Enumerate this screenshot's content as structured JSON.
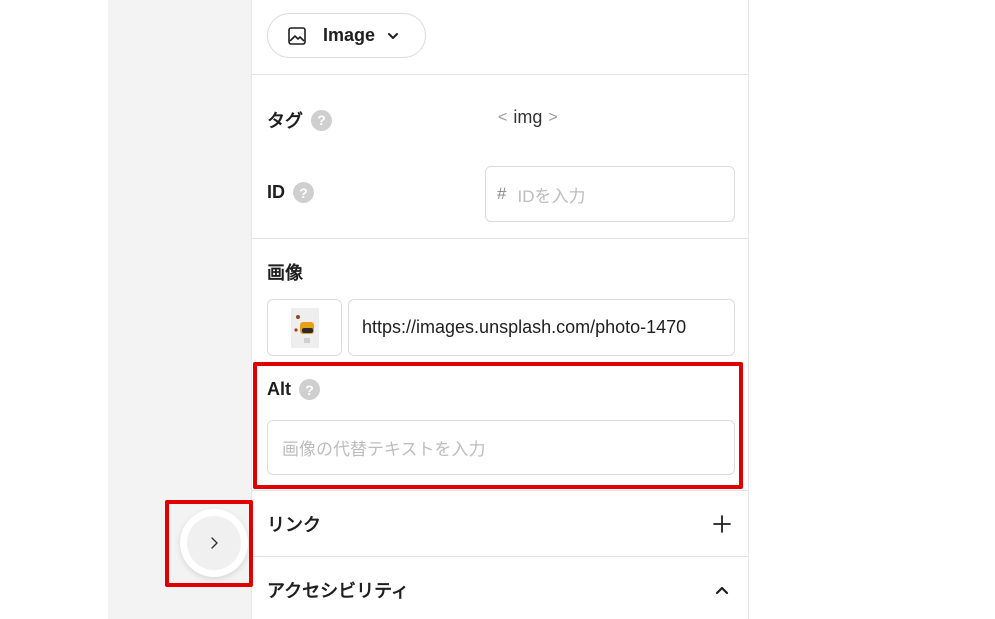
{
  "element_type": {
    "label": "Image",
    "icon": "image-icon"
  },
  "fields": {
    "tag": {
      "label": "タグ",
      "open": "<",
      "value": "img",
      "close": ">"
    },
    "id": {
      "label": "ID",
      "prefix": "#",
      "placeholder": "IDを入力",
      "value": ""
    }
  },
  "image": {
    "label": "画像",
    "url": "https://images.unsplash.com/photo-1470"
  },
  "alt": {
    "label": "Alt",
    "placeholder": "画像の代替テキストを入力",
    "value": ""
  },
  "sections": {
    "link": {
      "label": "リンク",
      "icon": "plus-icon"
    },
    "accessibility": {
      "label": "アクセシビリティ",
      "icon": "chevron-up-icon"
    }
  },
  "help_glyph": "?",
  "colors": {
    "highlight": "#e00000",
    "help_badge": "#cfcfcf",
    "canvas": "#f3f3f3"
  }
}
